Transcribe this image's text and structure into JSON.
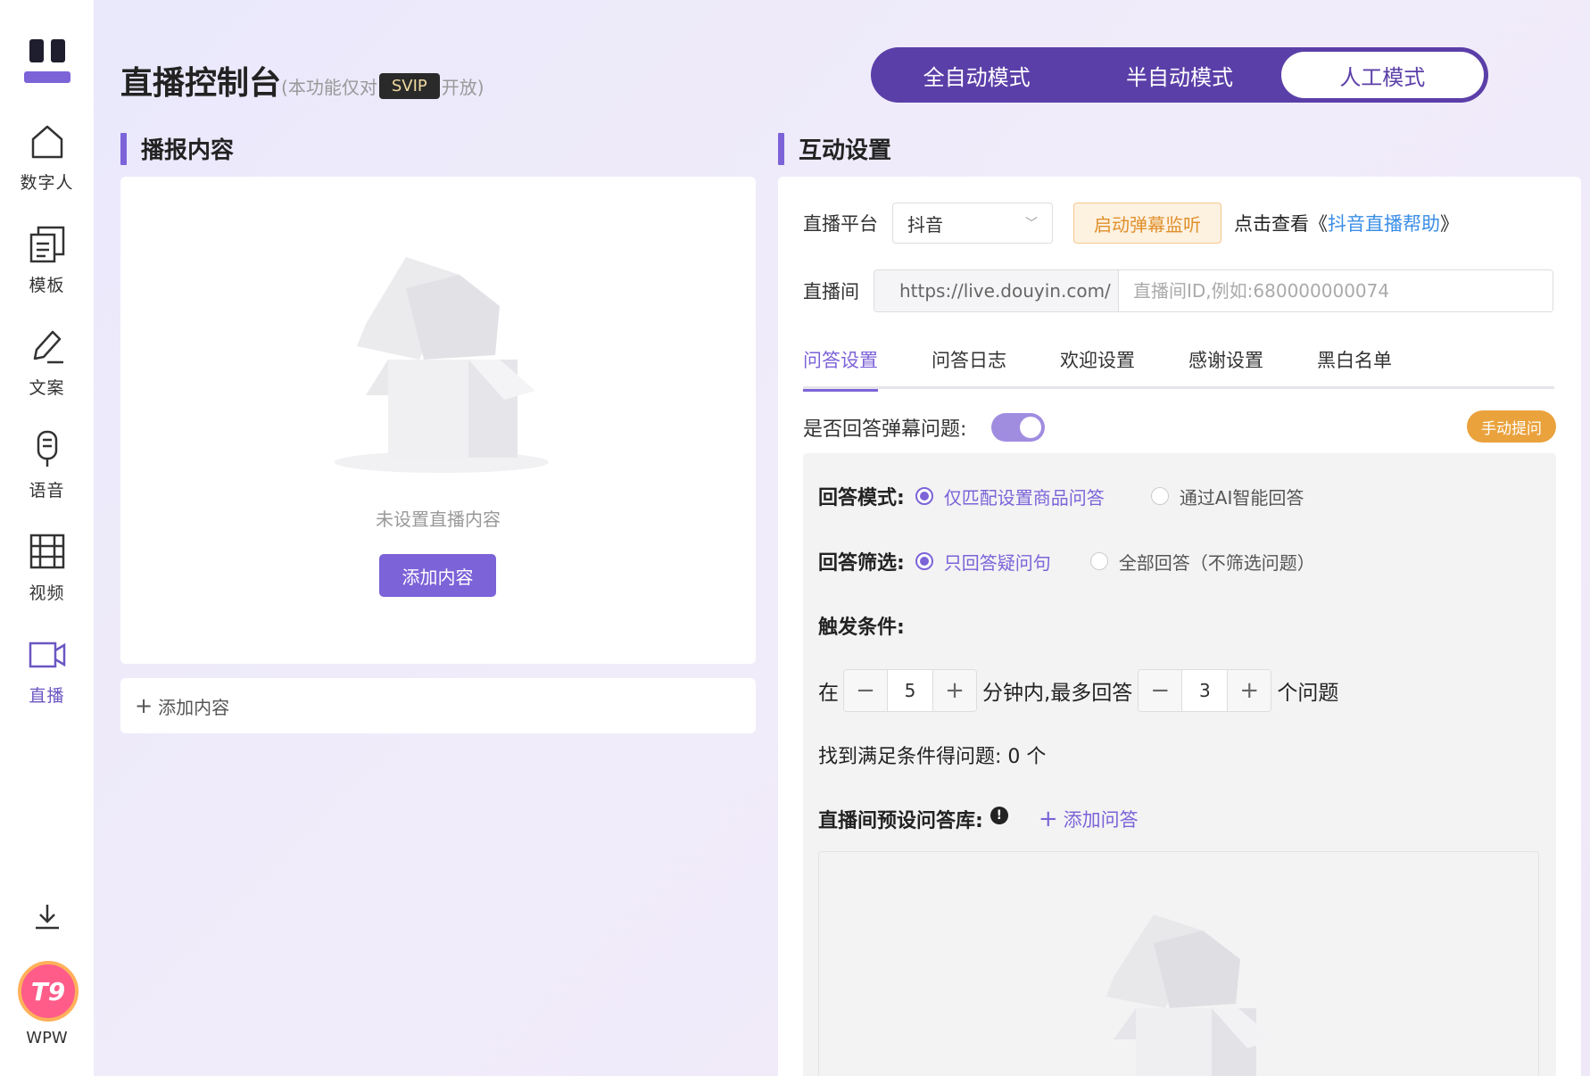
{
  "sidebar": {
    "items": [
      {
        "label": "数字人",
        "icon": "home-icon"
      },
      {
        "label": "模板",
        "icon": "template-icon"
      },
      {
        "label": "文案",
        "icon": "pen-icon"
      },
      {
        "label": "语音",
        "icon": "microphone-icon"
      },
      {
        "label": "视频",
        "icon": "film-icon"
      },
      {
        "label": "直播",
        "icon": "camera-icon",
        "active": true
      }
    ],
    "user": {
      "avatar_text": "T9",
      "name": "WPW"
    }
  },
  "header": {
    "title": "直播控制台",
    "note_prefix": "(本功能仅对",
    "note_badge": "SVIP",
    "note_suffix": "开放)"
  },
  "modes": [
    {
      "label": "全自动模式",
      "active": false
    },
    {
      "label": "半自动模式",
      "active": false
    },
    {
      "label": "人工模式",
      "active": true
    }
  ],
  "left": {
    "title": "播报内容",
    "empty_text": "未设置直播内容",
    "add_button": "添加内容",
    "add_row_label": "添加内容"
  },
  "right": {
    "title": "互动设置",
    "platform_label": "直播平台",
    "platform_value": "抖音",
    "monitor_button": "启动弹幕监听",
    "help_prefix": "点击查看《",
    "help_link": "抖音直播帮助",
    "help_suffix": "》",
    "room_label": "直播间",
    "room_prefix": "https://live.douyin.com/",
    "room_placeholder": "直播间ID,例如:680000000074",
    "tabs": [
      "问答设置",
      "问答日志",
      "欢迎设置",
      "感谢设置",
      "黑白名单"
    ],
    "answer_toggle_label": "是否回答弹幕问题:",
    "answer_toggle_on": true,
    "manual_button": "手动提问",
    "mode_label": "回答模式:",
    "mode_options": [
      "仅匹配设置商品问答",
      "通过AI智能回答"
    ],
    "filter_label": "回答筛选:",
    "filter_options": [
      "只回答疑问句",
      "全部回答（不筛选问题）"
    ],
    "trigger_label": "触发条件:",
    "trigger_in": "在",
    "minutes": "5",
    "trigger_mid": "分钟内,最多回答",
    "max_answers": "3",
    "trigger_end": "个问题",
    "found_text": "找到满足条件得问题: 0 个",
    "qa_lib_label": "直播间预设问答库:",
    "add_qa": "添加问答"
  },
  "colors": {
    "accent": "#7c63d8",
    "mode_bg": "#5b3fa8",
    "warning": "#eaa23d",
    "link": "#3a8ee6"
  }
}
